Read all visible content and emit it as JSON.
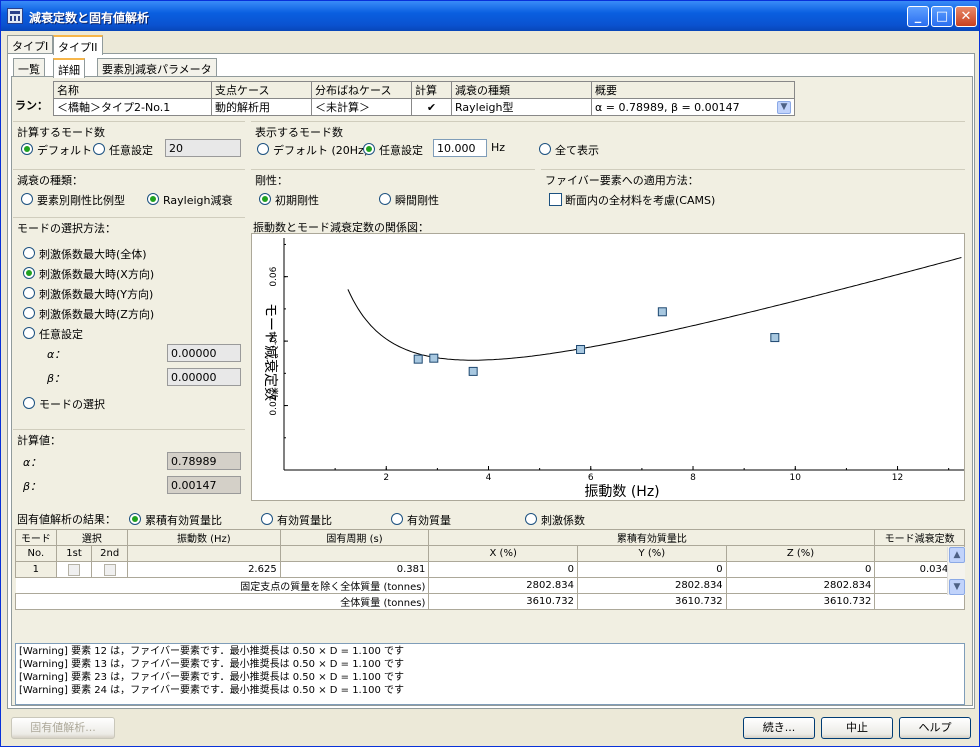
{
  "window": {
    "title": "減衰定数と固有値解析"
  },
  "titlebar_buttons": {
    "minimize": "_",
    "maximize": "□",
    "close": "✕"
  },
  "outer_tabs": [
    "タイプI",
    "タイプII"
  ],
  "inner_tabs": [
    "一覧",
    "詳細",
    "要素別減衰パラメータ"
  ],
  "run": {
    "label": "ラン：",
    "headers": [
      "名称",
      "支点ケース",
      "分布ばねケース",
      "計算",
      "減衰の種類",
      "概要"
    ],
    "values": [
      "＜橋軸＞タイプ2-No.1",
      "動的解析用",
      "＜未計算＞",
      "✔",
      "Rayleigh型",
      "α = 0.78989, β = 0.00147"
    ]
  },
  "mode_count": {
    "title": "計算するモード数",
    "default": "デフォルト",
    "custom": "任意設定",
    "value": "20"
  },
  "display_modes": {
    "title": "表示するモード数",
    "default": "デフォルト (20Hz)",
    "custom": "任意設定",
    "value": "10.000",
    "unit": "Hz",
    "all": "全て表示"
  },
  "damping_type": {
    "title": "減衰の種類：",
    "opt1": "要素別剛性比例型",
    "opt2": "Rayleigh減衰"
  },
  "stiffness": {
    "title": "剛性：",
    "opt1": "初期剛性",
    "opt2": "瞬間剛性"
  },
  "fiber": {
    "title": "ファイバー要素への適用方法：",
    "opt1": "断面内の全材料を考慮(CAMS)"
  },
  "mode_select": {
    "title": "モードの選択方法：",
    "options": [
      "刺激係数最大時(全体)",
      "刺激係数最大時(X方向)",
      "刺激係数最大時(Y方向)",
      "刺激係数最大時(Z方向)",
      "任意設定"
    ],
    "alpha_label": "α：",
    "beta_label": "β：",
    "alpha_value": "0.00000",
    "beta_value": "0.00000",
    "select_modes": "モードの選択"
  },
  "calc": {
    "title": "計算値：",
    "alpha_label": "α：",
    "beta_label": "β：",
    "alpha": "0.78989",
    "beta": "0.00147"
  },
  "chart_title": "振動数とモード減衰定数の関係図：",
  "chart_data": {
    "type": "scatter",
    "xlabel": "振動数 (Hz)",
    "ylabel": "モード減衰定数",
    "xlim": [
      0,
      13.3
    ],
    "ylim": [
      0.0,
      0.072
    ],
    "xticks": [
      "2",
      "4",
      "6",
      "8",
      "10",
      "12"
    ],
    "yticks": [
      "0.02",
      "0.04",
      "0.06"
    ],
    "points": [
      {
        "x": 2.625,
        "y": 0.0344
      },
      {
        "x": 2.93,
        "y": 0.0347
      },
      {
        "x": 3.7,
        "y": 0.0306
      },
      {
        "x": 5.8,
        "y": 0.0374
      },
      {
        "x": 7.4,
        "y": 0.0491
      },
      {
        "x": 9.6,
        "y": 0.0411
      }
    ],
    "curve": {
      "alpha": 0.78989,
      "beta": 0.00147
    },
    "grid": false
  },
  "results": {
    "title": "固有値解析の結果：",
    "opts": [
      "累積有効質量比",
      "有効質量比",
      "有効質量",
      "刺激係数"
    ]
  },
  "table": {
    "h_mode": "モード",
    "h_select": "選択",
    "h_freq": "振動数 (Hz)",
    "h_period": "固有周期 (s)",
    "h_cum": "累積有効質量比",
    "h_damp": "モード減衰定数",
    "h_no": "No.",
    "h_1st": "1st",
    "h_2nd": "2nd",
    "h_x": "X (%)",
    "h_y": "Y (%)",
    "h_z": "Z (%)",
    "row1": {
      "no": "1",
      "freq": "2.625",
      "period": "0.381",
      "x": "0",
      "y": "0",
      "z": "0",
      "damp": "0.03436"
    },
    "sum_label1": "固定支点の質量を除く全体質量 (tonnes)",
    "sum1": [
      "2802.834",
      "2802.834",
      "2802.834"
    ],
    "sum_label2": "全体質量 (tonnes)",
    "sum2": [
      "3610.732",
      "3610.732",
      "3610.732"
    ]
  },
  "log": [
    "[Warning] 要素 12 は，ファイバー要素です．最小推奨長は 0.50 × D =  1.100 です",
    "[Warning] 要素 13 は，ファイバー要素です．最小推奨長は 0.50 × D =  1.100 です",
    "[Warning] 要素 23 は，ファイバー要素です．最小推奨長は 0.50 × D =  1.100 です",
    "[Warning] 要素 24 は，ファイバー要素です．最小推奨長は 0.50 × D =  1.100 です"
  ],
  "buttons": {
    "eigen": "固有値解析...",
    "continue": "続き...",
    "cancel": "中止",
    "help": "ヘルプ"
  }
}
